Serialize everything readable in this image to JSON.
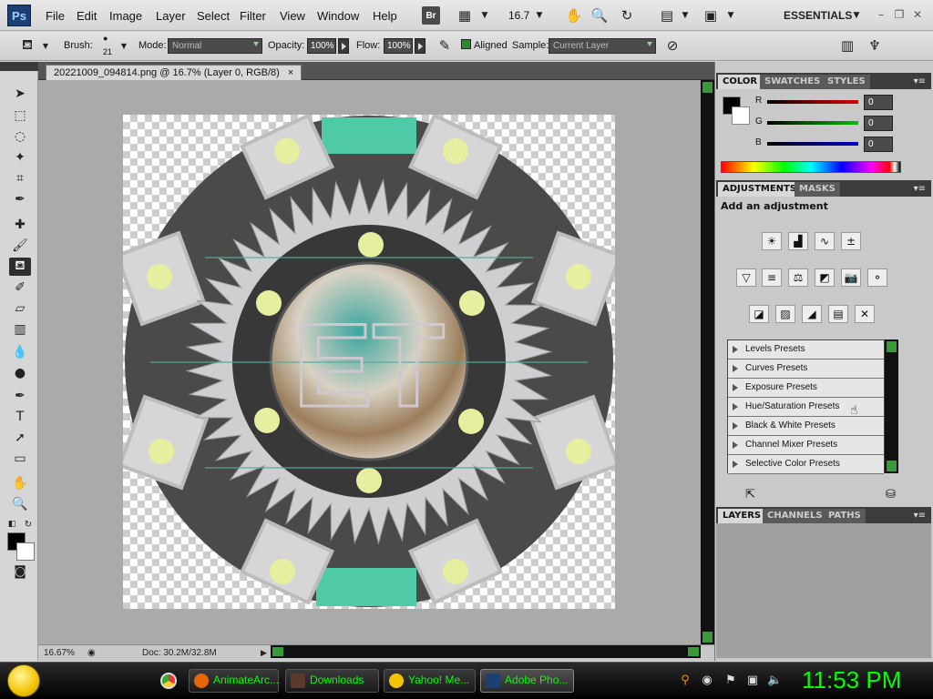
{
  "app": {
    "logo": "Ps",
    "menu": [
      "File",
      "Edit",
      "Image",
      "Layer",
      "Select",
      "Filter",
      "View",
      "Window",
      "Help"
    ],
    "zoom_display": "16.7",
    "workspace": "ESSENTIALS",
    "bridge_label": "Br"
  },
  "options": {
    "brush_label": "Brush:",
    "brush_size": "21",
    "mode_label": "Mode:",
    "mode_value": "Normal",
    "opacity_label": "Opacity:",
    "opacity_value": "100%",
    "flow_label": "Flow:",
    "flow_value": "100%",
    "aligned_label": "Aligned",
    "aligned_checked": true,
    "sample_label": "Sample:",
    "sample_value": "Current Layer"
  },
  "document": {
    "tab_title": "20221009_094814.png @ 16.7% (Layer 0, RGB/8)",
    "close": "×",
    "artwork_text": "ET",
    "status_zoom": "16.67%",
    "status_doc": "Doc: 30.2M/32.8M"
  },
  "color_panel": {
    "tabs": [
      "COLOR",
      "SWATCHES",
      "STYLES"
    ],
    "r_label": "R",
    "g_label": "G",
    "b_label": "B",
    "r_value": "0",
    "g_value": "0",
    "b_value": "0",
    "colors": {
      "r": "#e00000",
      "g": "#00c000",
      "b": "#0000d0"
    }
  },
  "adjustments_panel": {
    "tabs": [
      "ADJUSTMENTS",
      "MASKS"
    ],
    "heading": "Add an adjustment",
    "presets": [
      "Levels Presets",
      "Curves Presets",
      "Exposure Presets",
      "Hue/Saturation Presets",
      "Black & White Presets",
      "Channel Mixer Presets",
      "Selective Color Presets"
    ]
  },
  "layers_panel": {
    "tabs": [
      "LAYERS",
      "CHANNELS",
      "PATHS"
    ]
  },
  "taskbar": {
    "items": [
      "AnimateArc...",
      "Downloads",
      "Yahoo! Me...",
      "Adobe Pho..."
    ],
    "clock": "11:53 PM",
    "accent": "#00ff00"
  }
}
